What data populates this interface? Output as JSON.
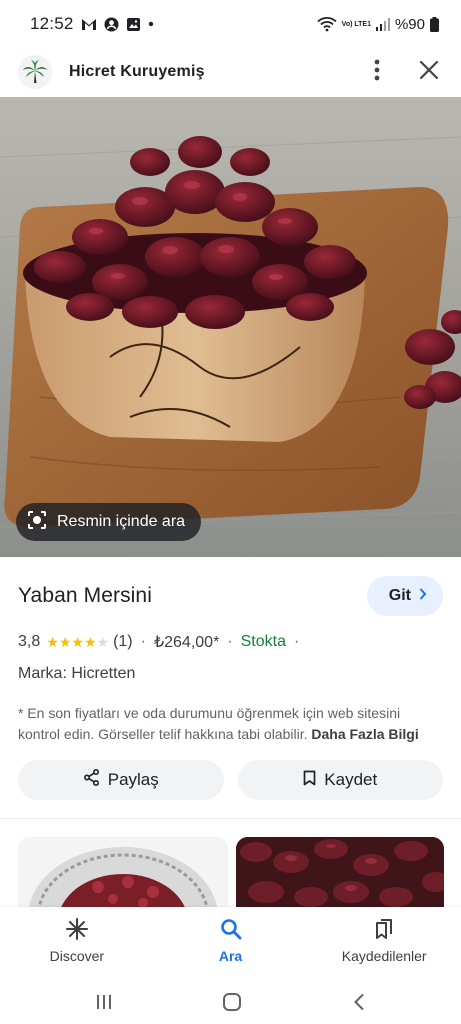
{
  "status_bar": {
    "time": "12:52",
    "battery": "%90",
    "network_label": "Vo) LTE1",
    "left_icons": [
      "gmail-icon",
      "account-icon",
      "gallery-icon",
      "dot-icon"
    ],
    "right_icons": [
      "wifi-icon",
      "volte-icon",
      "signal-icon",
      "battery-icon"
    ]
  },
  "header": {
    "site_name": "Hicret Kuruyemiş",
    "logo_icon": "palm-tree-logo",
    "more_icon": "more-vert-icon",
    "close_icon": "close-icon"
  },
  "hero": {
    "image_subject": "dried-cranberries-in-wooden-bowl",
    "lens_chip_label": "Resmin içinde ara",
    "lens_icon": "lens-icon"
  },
  "product": {
    "title": "Yaban Mersini",
    "visit_button_label": "Git",
    "rating": "3,8",
    "star_fill": 3.8,
    "stars_max": 5,
    "review_count": "(1)",
    "separator": "·",
    "price": "₺264,00*",
    "stock": "Stokta",
    "brand": "Marka: Hicretten",
    "disclaimer": "* En son fiyatları ve oda durumunu öğrenmek için web sitesini kontrol edin. Görseller telif hakkına tabi olabilir.",
    "more_info_link": "Daha Fazla Bilgi",
    "share_label": "Paylaş",
    "save_label": "Kaydet"
  },
  "bottom_nav": {
    "items": [
      {
        "label": "Discover",
        "icon": "asterisk-icon"
      },
      {
        "label": "Ara",
        "icon": "search-icon",
        "active": true
      },
      {
        "label": "Kaydedilenler",
        "icon": "bookmarks-icon"
      }
    ]
  },
  "colors": {
    "accent": "#1a73e8",
    "stock_green": "#188038",
    "star": "#fbbc04",
    "chip_bg": "#e8f0fe"
  }
}
